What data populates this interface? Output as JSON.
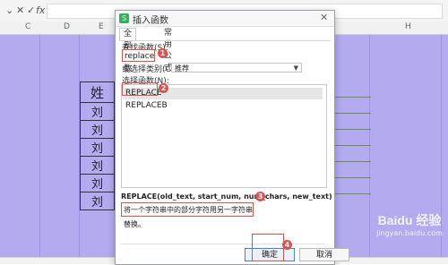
{
  "formula_bar": {
    "fx_label": "fx"
  },
  "columns": [
    "C",
    "D",
    "E",
    "H"
  ],
  "sheet_cells": {
    "header": "姓",
    "rows": [
      "刘",
      "刘",
      "刘",
      "刘",
      "刘",
      "刘"
    ]
  },
  "dialog": {
    "title": "插入函数",
    "tabs": [
      "全部函数",
      "常用公式"
    ],
    "search_label": "查找函数(S):",
    "search_value": "replace",
    "category_label": "或选择类别(C):",
    "category_value": "推荐",
    "list_label": "选择函数(N):",
    "functions": [
      "REPLACE",
      "REPLACEB"
    ],
    "syntax": "REPLACE(old_text, start_num, num_chars, new_text)",
    "description": "将一个字符串中的部分字符用另一字符串替换。",
    "ok_label": "确定",
    "cancel_label": "取消"
  },
  "markers": [
    "1",
    "2",
    "3",
    "4"
  ],
  "watermark": {
    "logo": "Baidu 经验",
    "url": "jingyan.baidu.com"
  },
  "colors": {
    "sheet_bg": "#b3aaef",
    "accent": "#d9534f",
    "wps_green": "#2fb35a"
  }
}
